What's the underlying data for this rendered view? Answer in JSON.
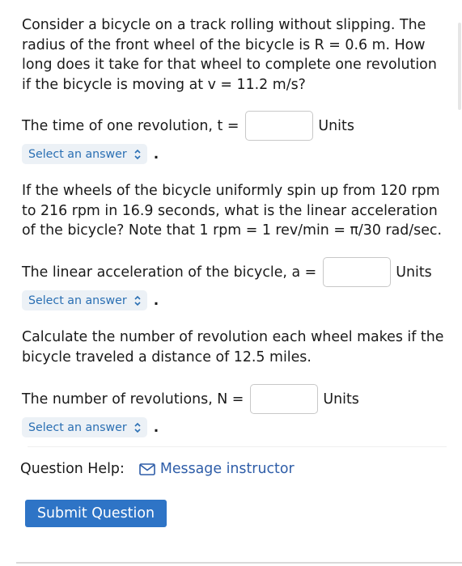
{
  "question1": {
    "text": "Consider a bicycle on a track rolling without slipping. The radius of the front wheel of the bicycle is R = 0.6 m. How long does it take for that wheel to complete one revolution if the bicycle is moving at v = 11.2 m/s?",
    "label": "The time of one revolution, t =",
    "units": "Units",
    "select_placeholder": "Select an answer"
  },
  "question2": {
    "text": "If the wheels of the bicycle uniformly spin up from 120 rpm to 216 rpm in 16.9 seconds, what is the linear acceleration of the bicycle? Note that 1 rpm = 1 rev/min = π/30 rad/sec.",
    "label": "The linear acceleration of the bicycle, a =",
    "units": "Units",
    "select_placeholder": "Select an answer"
  },
  "question3": {
    "text": "Calculate the number of revolution each wheel makes if the bicycle traveled a distance of 12.5 miles.",
    "label": "The number of revolutions, N =",
    "units": "Units",
    "select_placeholder": "Select an answer"
  },
  "help": {
    "label": "Question Help:",
    "message_link": "Message instructor",
    "message_icon": "envelope-icon"
  },
  "submit_label": "Submit Question",
  "colors": {
    "link": "#2e5da8",
    "select_text": "#2a6fb3",
    "select_bg": "#ecf1f6",
    "submit_bg": "#2e74c6"
  }
}
